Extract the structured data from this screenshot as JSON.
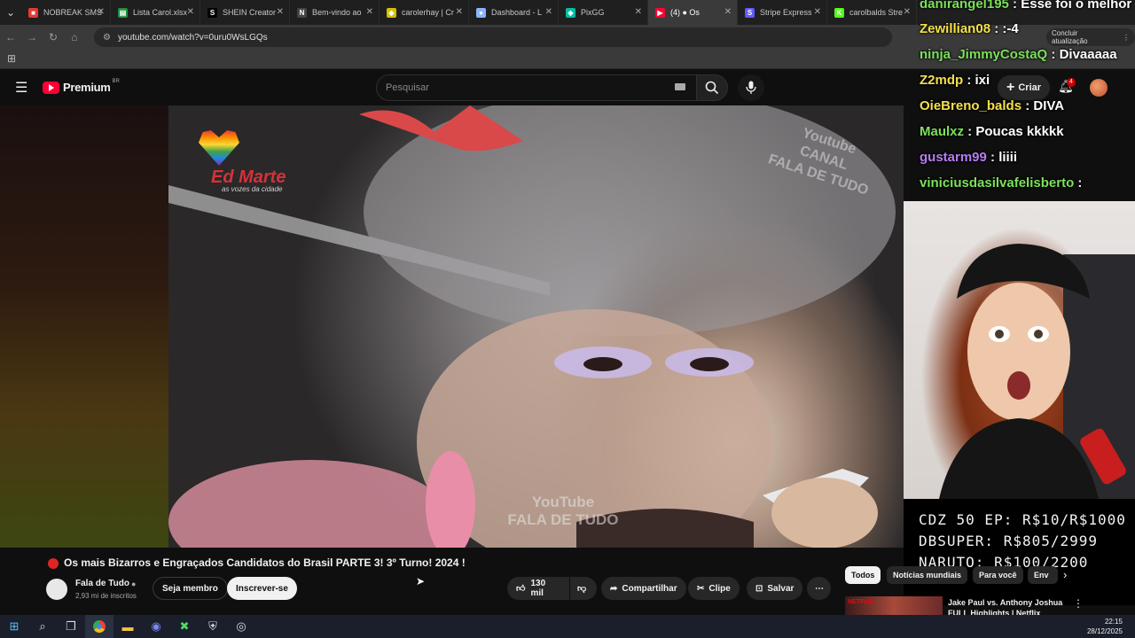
{
  "browser": {
    "tabs": [
      {
        "label": "NOBREAK SMS",
        "color": "#e53935",
        "glyph": "■"
      },
      {
        "label": "Lista Carol.xlsx",
        "color": "#1e8e3e",
        "glyph": "▤"
      },
      {
        "label": "SHEIN Creator",
        "color": "#000000",
        "glyph": "S"
      },
      {
        "label": "Bem-vindo ao",
        "color": "#444444",
        "glyph": "N"
      },
      {
        "label": "carolerhay | Cr",
        "color": "#d4c000",
        "glyph": "◆"
      },
      {
        "label": "Dashboard - L",
        "color": "#8ab4f8",
        "glyph": "●"
      },
      {
        "label": "PixGG",
        "color": "#00bfa5",
        "glyph": "◈"
      },
      {
        "label": "(4) ● Os",
        "color": "#ff0033",
        "glyph": "▶"
      },
      {
        "label": "Stripe Express",
        "color": "#635bff",
        "glyph": "S"
      },
      {
        "label": "carolbalds Stre",
        "color": "#53fc18",
        "glyph": "K"
      }
    ],
    "url": "youtube.com/watch?v=0uru0WsLGQs",
    "update_button": "Concluir atualização"
  },
  "youtube": {
    "logo_text": "Premium",
    "logo_region": "BR",
    "search_placeholder": "Pesquisar",
    "create_label": "Criar",
    "notification_count": "4",
    "video_title": "Os mais Bizarros e Engraçados Candidatos do Brasil PARTE 3! 3º Turno! 2024 !",
    "channel_name": "Fala de Tudo",
    "subscribers": "2,93 mi de inscritos",
    "join_label": "Seja membro",
    "subscribe_label": "Inscrever-se",
    "likes": "130 mil",
    "share_label": "Compartilhar",
    "clip_label": "Clipe",
    "save_label": "Salvar",
    "chips": [
      "Todos",
      "Notícias mundiais",
      "Para você",
      "Env"
    ],
    "recommended_title_line1": "Jake Paul vs. Anthony Joshua",
    "recommended_title_line2": "FULL Highlights | Netflix",
    "recommended_badge": "NETFLIX",
    "watermark_left_line1": "Ed Marte",
    "watermark_left_line2": "as vozes da cidade",
    "watermark_right_line1": "Youtube",
    "watermark_right_line2": "CANAL",
    "watermark_right_line3": "FALA DE TUDO",
    "watermark_bottom_line1": "YouTube",
    "watermark_bottom_line2": "FALA DE TUDO"
  },
  "chat": [
    {
      "user": "danirangel195",
      "message": "Esse foi o melhor",
      "color": "#7be15a"
    },
    {
      "user": "Zewillian08",
      "message": ":-4",
      "color": "#f5e04a"
    },
    {
      "user": "ninja_JimmyCostaQ",
      "message": "Divaaaaa",
      "color": "#7be15a"
    },
    {
      "user": "Z2mdp",
      "message": "ixi",
      "color": "#f5e04a"
    },
    {
      "user": "OieBreno_balds",
      "message": "DIVA",
      "color": "#f5e04a"
    },
    {
      "user": "Maulxz",
      "message": "Poucas kkkkk",
      "color": "#7be15a"
    },
    {
      "user": "gustarm99",
      "message": "liiii",
      "color": "#b77cf2"
    },
    {
      "user": "viniciusdasilvafelisberto",
      "message": "",
      "color": "#7be15a"
    }
  ],
  "prices": [
    "CDZ 50 EP: R$10/R$1000",
    "DBSUPER: R$805/2999",
    "NARUTO: R$100/2200"
  ],
  "clock": {
    "time": "22:15",
    "date": "28/12/2025"
  }
}
